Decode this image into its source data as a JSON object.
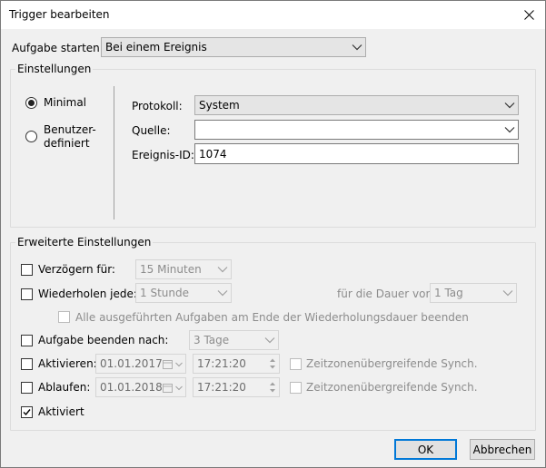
{
  "window": {
    "title": "Trigger bearbeiten"
  },
  "start": {
    "label": "Aufgabe starten:",
    "value": "Bei einem Ereignis"
  },
  "settings": {
    "group_title": "Einstellungen",
    "radio_minimal": "Minimal",
    "radio_custom_line1": "Benutzer-",
    "radio_custom_line2": "definiert",
    "protokoll_label": "Protokoll:",
    "protokoll_value": "System",
    "quelle_label": "Quelle:",
    "quelle_value": "",
    "ereignis_label": "Ereignis-ID:",
    "ereignis_value": "1074"
  },
  "advanced": {
    "group_title": "Erweiterte Einstellungen",
    "delay_label": "Verzögern für:",
    "delay_value": "15 Minuten",
    "repeat_label": "Wiederholen jede:",
    "repeat_value": "1 Stunde",
    "duration_label": "für die Dauer von:",
    "duration_value": "1 Tag",
    "stop_all_label": "Alle ausgeführten Aufgaben am Ende der Wiederholungsdauer beenden",
    "stop_after_label": "Aufgabe beenden nach:",
    "stop_after_value": "3 Tage",
    "activate_label": "Aktivieren:",
    "activate_date": "01.01.2017",
    "activate_time": "17:21:20",
    "activate_sync": "Zeitzonenübergreifende Synch.",
    "expire_label": "Ablaufen:",
    "expire_date": "01.01.2018",
    "expire_time": "17:21:20",
    "expire_sync": "Zeitzonenübergreifende Synch.",
    "enabled_label": "Aktiviert"
  },
  "buttons": {
    "ok": "OK",
    "cancel": "Abbrechen"
  }
}
